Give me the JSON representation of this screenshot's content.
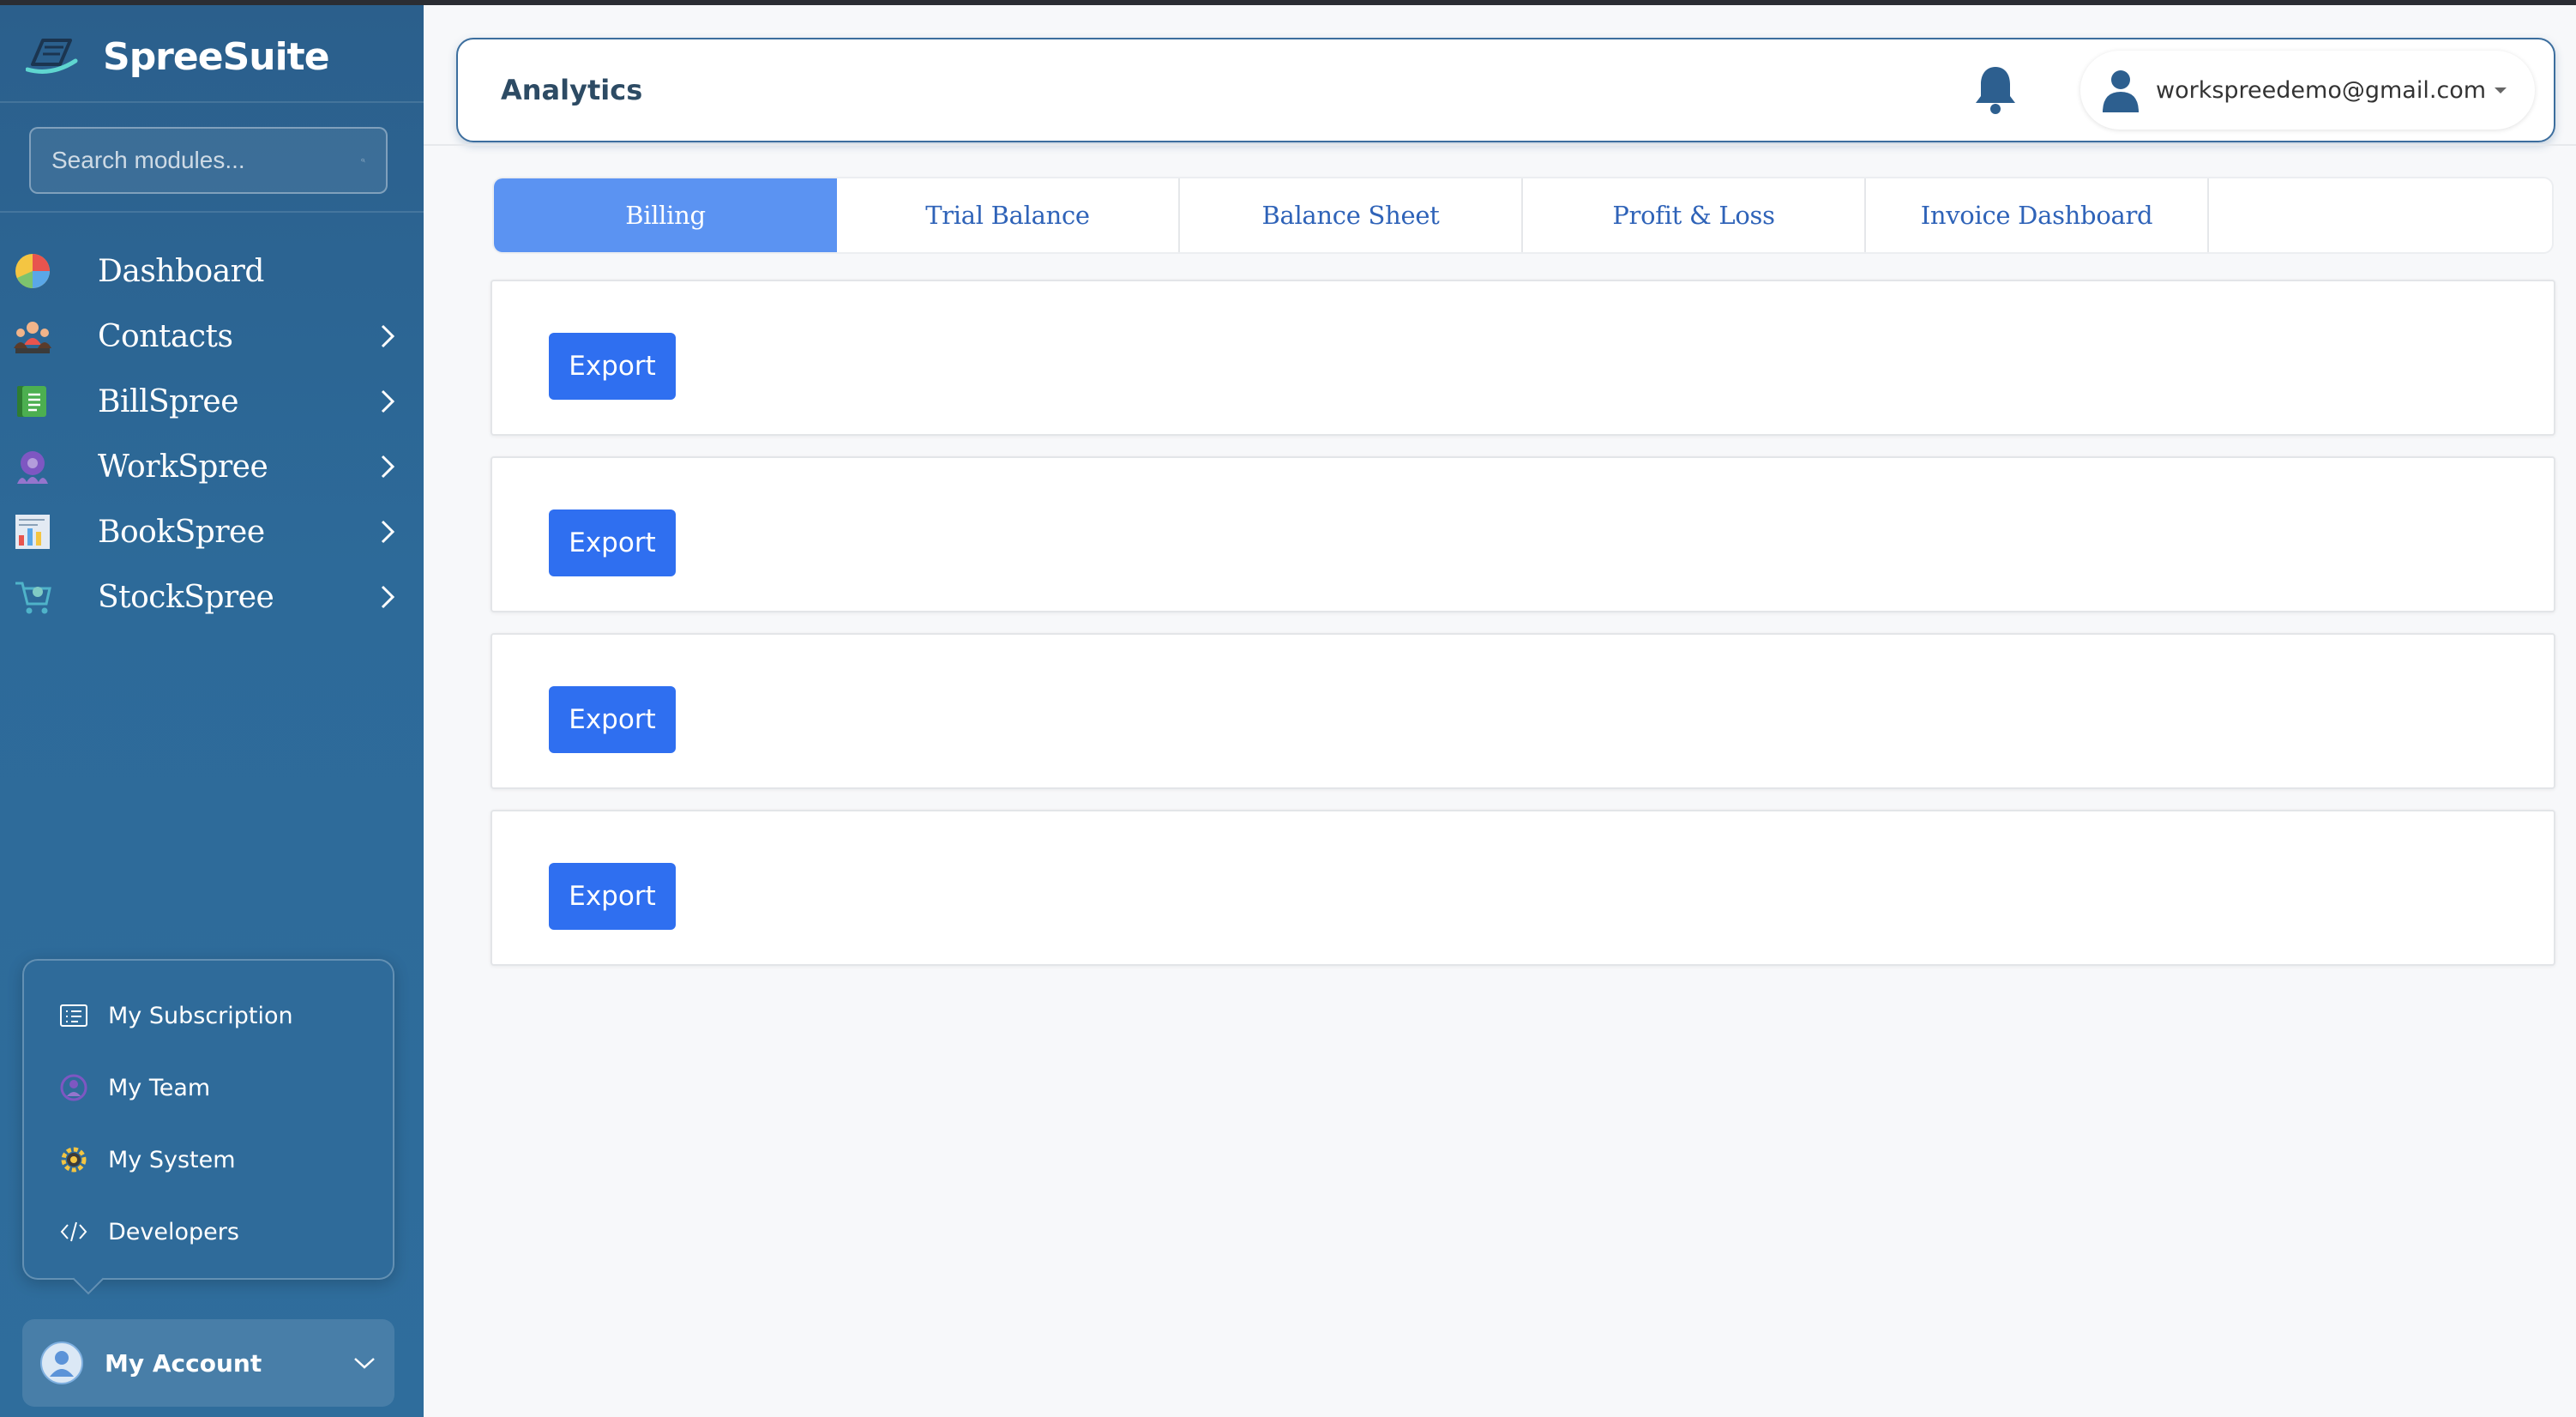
{
  "sidebar": {
    "brand": "SpreeSuite",
    "search_placeholder": "Search modules...",
    "nav": [
      {
        "label": "Dashboard",
        "icon": "pie-chart-icon",
        "has_children": false
      },
      {
        "label": "Contacts",
        "icon": "people-icon",
        "has_children": true
      },
      {
        "label": "BillSpree",
        "icon": "invoice-icon",
        "has_children": true
      },
      {
        "label": "WorkSpree",
        "icon": "team-gear-icon",
        "has_children": true
      },
      {
        "label": "BookSpree",
        "icon": "ledger-icon",
        "has_children": true
      },
      {
        "label": "StockSpree",
        "icon": "cart-icon",
        "has_children": true
      }
    ],
    "menu": [
      {
        "label": "My Subscription",
        "icon": "subscription-icon"
      },
      {
        "label": "My Team",
        "icon": "team-icon"
      },
      {
        "label": "My System",
        "icon": "gear-icon"
      },
      {
        "label": "Developers",
        "icon": "code-icon"
      }
    ],
    "account_label": "My Account"
  },
  "header": {
    "title": "Analytics",
    "user_email": "workspreedemo@gmail.com"
  },
  "tabs": [
    {
      "label": "Billing",
      "active": true
    },
    {
      "label": "Trial Balance",
      "active": false
    },
    {
      "label": "Balance Sheet",
      "active": false
    },
    {
      "label": "Profit & Loss",
      "active": false
    },
    {
      "label": "Invoice Dashboard",
      "active": false
    }
  ],
  "cards": [
    {
      "export_label": "Export"
    },
    {
      "export_label": "Export"
    },
    {
      "export_label": "Export"
    },
    {
      "export_label": "Export"
    }
  ],
  "colors": {
    "sidebar": "#2d6a99",
    "accent": "#2f6ff0",
    "active_tab": "#5b93f2",
    "header_border": "#3c6e9e"
  }
}
